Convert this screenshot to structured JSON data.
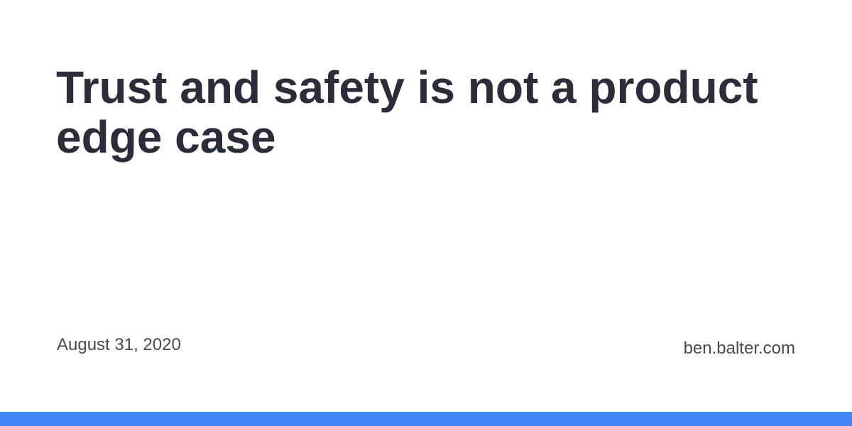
{
  "post": {
    "title": "Trust and safety is not a product edge case",
    "date": "August 31, 2020",
    "site": "ben.balter.com"
  },
  "colors": {
    "accent_bar": "#4285f4",
    "title_text": "#2b2d3a",
    "meta_text": "#4a4a4a",
    "background": "#ffffff"
  }
}
